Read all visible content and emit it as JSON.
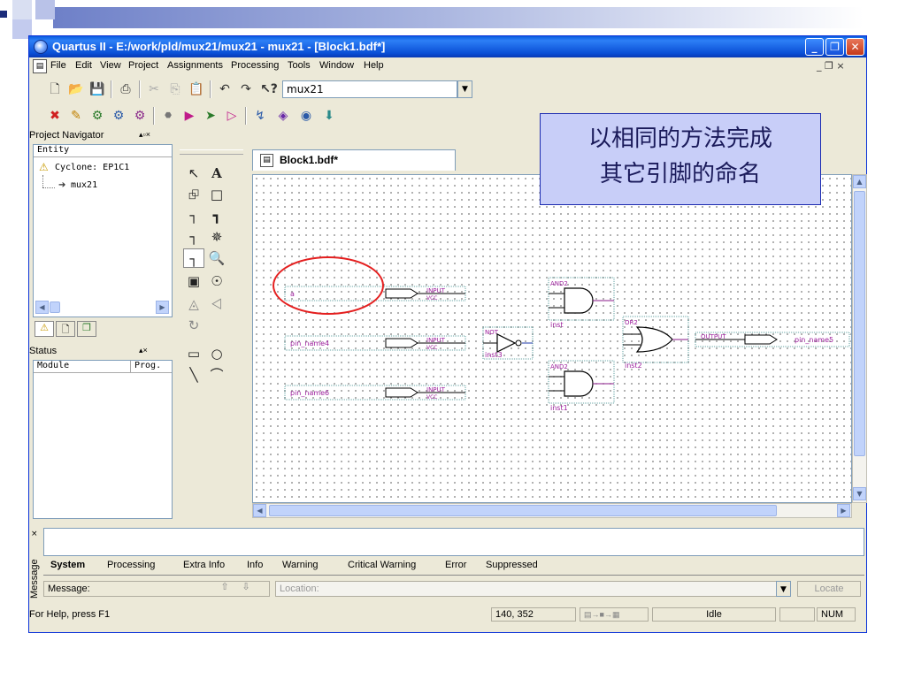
{
  "window": {
    "title": "Quartus II - E:/work/pld/mux21/mux21 - mux21 - [Block1.bdf*]"
  },
  "menu": {
    "items": [
      "File",
      "Edit",
      "View",
      "Project",
      "Assignments",
      "Processing",
      "Tools",
      "Window",
      "Help"
    ],
    "mdi_controls": "_ ❐ ×"
  },
  "toolbar": {
    "project_combo": "mux21"
  },
  "project_navigator": {
    "title": "Project Navigator",
    "column": "Entity",
    "device": "Cyclone: EP1C1",
    "entity": "mux21"
  },
  "status_pane": {
    "title": "Status",
    "col_module": "Module",
    "col_prog": "Prog."
  },
  "document": {
    "tab_label": "Block1.bdf*"
  },
  "schematic": {
    "pins": [
      {
        "name": "a",
        "type": "INPUT",
        "vcc": "VCC"
      },
      {
        "name": "pin_name4",
        "type": "INPUT",
        "vcc": "VCC"
      },
      {
        "name": "pin_name6",
        "type": "INPUT",
        "vcc": "VCC"
      }
    ],
    "gates": [
      {
        "kind": "AND2",
        "inst": "inst"
      },
      {
        "kind": "NOT",
        "inst": "inst3"
      },
      {
        "kind": "OR2",
        "inst": "inst2"
      },
      {
        "kind": "AND2",
        "inst": "inst1"
      }
    ],
    "output": {
      "type": "OUTPUT",
      "name": "pin_name5"
    }
  },
  "callout": {
    "line1": "以相同的方法完成",
    "line2": "其它引脚的命名"
  },
  "messages": {
    "side_label": "Message",
    "tabs": [
      "System",
      "Processing",
      "Extra Info",
      "Info",
      "Warning",
      "Critical Warning",
      "Error",
      "Suppressed"
    ],
    "message_label": "Message:",
    "location_placeholder": "Location:",
    "locate_button": "Locate"
  },
  "statusbar": {
    "help": "For Help, press F1",
    "coords": "140, 352",
    "state": "Idle",
    "num": "NUM"
  },
  "colors": {
    "schematic_label": "#9c1d9c",
    "schematic_wire": "#1e3aa8",
    "annotation": "#e41f1f",
    "callout_bg": "#c8cef8"
  }
}
